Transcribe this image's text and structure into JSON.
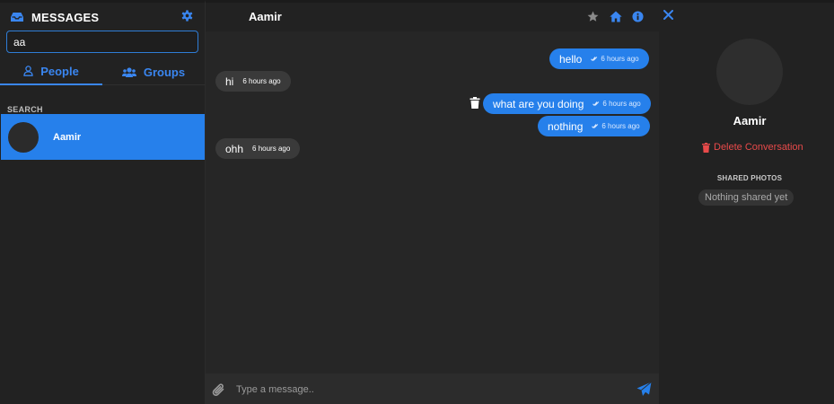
{
  "sidebar": {
    "title": "MESSAGES",
    "search": {
      "value": "aa",
      "placeholder": ""
    },
    "tabs": [
      {
        "label": "People",
        "icon": "user-icon",
        "active": true
      },
      {
        "label": "Groups",
        "icon": "users-icon",
        "active": false
      }
    ],
    "section_label": "SEARCH",
    "contacts": [
      {
        "name": "Aamir",
        "selected": true
      }
    ]
  },
  "chat": {
    "contact_name": "Aamir",
    "header_icons": [
      "star-icon",
      "home-icon",
      "info-icon"
    ],
    "messages": [
      {
        "direction": "out",
        "text": "hello",
        "time": "6 hours ago"
      },
      {
        "direction": "in",
        "text": "hi",
        "time": "6 hours ago"
      },
      {
        "direction": "out",
        "text": "what are you doing",
        "time": "6 hours ago"
      },
      {
        "direction": "out",
        "text": "nothing",
        "time": "6 hours ago"
      },
      {
        "direction": "in",
        "text": "ohh",
        "time": "6 hours ago"
      }
    ],
    "composer": {
      "placeholder": "Type a message.."
    }
  },
  "info_panel": {
    "name": "Aamir",
    "delete_label": "Delete Conversation",
    "shared_photos_label": "SHARED PHOTOS",
    "shared_photos_empty": "Nothing shared yet"
  },
  "colors": {
    "accent": "#2680eb",
    "incoming_bubble": "#3a3a3a",
    "danger": "#e84a4a",
    "background": "#232323"
  }
}
